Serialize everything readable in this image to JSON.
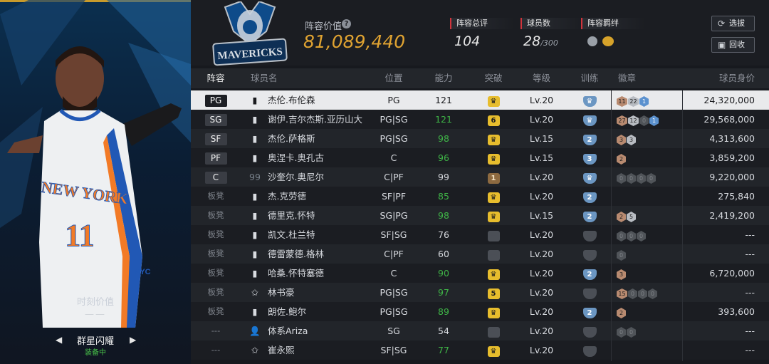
{
  "left_panel": {
    "moment_label": "时刻价值",
    "moment_value": "——",
    "outfit_name": "群星闪耀",
    "equipped_label": "装备中",
    "player_jersey": {
      "team_text": "NEW YORK",
      "number": "11",
      "short": "NYC"
    }
  },
  "header": {
    "team_logo_text": "MAVERICKS",
    "lineup_value_label": "阵容价值",
    "lineup_value": "81,089,440",
    "overall_label": "阵容总评",
    "overall_value": "104",
    "player_count_label": "球员数",
    "player_count_value": "28",
    "player_count_max": "/300",
    "bond_label": "阵容羁绊",
    "select_label": "选拔",
    "back_label": "回收"
  },
  "table": {
    "headers": [
      "阵容",
      "球员名",
      "位置",
      "能力",
      "突破",
      "等级",
      "训练",
      "徽章",
      "球员身价"
    ],
    "rows": [
      {
        "slot": "PG",
        "name": "杰伦.布伦森",
        "pos": "PG",
        "ovr": "121",
        "ovr_green": false,
        "brk": "crown",
        "lv": "Lv.20",
        "train": "crown",
        "badges": [
          [
            "11",
            "bronze"
          ],
          [
            "22",
            "silver"
          ],
          [
            "1",
            "blue"
          ]
        ],
        "value": "24,320,000",
        "selected": true,
        "icon": "bars"
      },
      {
        "slot": "SG",
        "name": "谢伊.吉尔杰斯.亚历山大",
        "pos": "PG|SG",
        "ovr": "121",
        "ovr_green": true,
        "brk": "6",
        "lv": "Lv.20",
        "train": "crown",
        "badges": [
          [
            "27",
            "bronze"
          ],
          [
            "12",
            "silver"
          ],
          [
            "0",
            "grey"
          ],
          [
            "1",
            "blue"
          ]
        ],
        "value": "29,568,000",
        "icon": "bars"
      },
      {
        "slot": "SF",
        "name": "杰伦.萨格斯",
        "pos": "PG|SG",
        "ovr": "98",
        "ovr_green": true,
        "brk": "crown",
        "lv": "Lv.15",
        "train": "2",
        "badges": [
          [
            "3",
            "bronze"
          ],
          [
            "3",
            "silver"
          ]
        ],
        "value": "4,313,600",
        "icon": "bars"
      },
      {
        "slot": "PF",
        "name": "奥涅卡.奥孔古",
        "pos": "C",
        "ovr": "96",
        "ovr_green": true,
        "brk": "crown",
        "lv": "Lv.15",
        "train": "3",
        "badges": [
          [
            "2",
            "bronze"
          ]
        ],
        "value": "3,859,200",
        "icon": "bars"
      },
      {
        "slot": "C",
        "name": "沙奎尔.奥尼尔",
        "pos": "C|PF",
        "ovr": "99",
        "ovr_green": false,
        "brk": "1b",
        "lv": "Lv.20",
        "train": "crown",
        "badges": [
          [
            "0",
            "grey"
          ],
          [
            "0",
            "grey"
          ],
          [
            "0",
            "grey"
          ],
          [
            "0",
            "grey"
          ]
        ],
        "value": "9,220,000",
        "icon": "99"
      },
      {
        "slot": "板凳",
        "name": "杰.克劳德",
        "pos": "SF|PF",
        "ovr": "85",
        "ovr_green": true,
        "brk": "crown",
        "lv": "Lv.20",
        "train": "2",
        "badges": [],
        "value": "275,840",
        "icon": "bars"
      },
      {
        "slot": "板凳",
        "name": "德里克.怀特",
        "pos": "SG|PG",
        "ovr": "98",
        "ovr_green": true,
        "brk": "crown",
        "lv": "Lv.15",
        "train": "2",
        "badges": [
          [
            "2",
            "bronze"
          ],
          [
            "5",
            "silver"
          ]
        ],
        "value": "2,419,200",
        "icon": "bars"
      },
      {
        "slot": "板凳",
        "name": "凯文.杜兰特",
        "pos": "SF|SG",
        "ovr": "76",
        "ovr_green": false,
        "brk": "grey",
        "lv": "Lv.20",
        "train": "grey",
        "badges": [
          [
            "0",
            "grey"
          ],
          [
            "0",
            "grey"
          ],
          [
            "0",
            "grey"
          ]
        ],
        "value": "---",
        "icon": "bars"
      },
      {
        "slot": "板凳",
        "name": "德雷蒙德.格林",
        "pos": "C|PF",
        "ovr": "60",
        "ovr_green": false,
        "brk": "grey",
        "lv": "Lv.20",
        "train": "grey",
        "badges": [
          [
            "0",
            "grey"
          ]
        ],
        "value": "---",
        "icon": "bars"
      },
      {
        "slot": "板凳",
        "name": "哈桑.怀特塞德",
        "pos": "C",
        "ovr": "90",
        "ovr_green": true,
        "brk": "crown",
        "lv": "Lv.20",
        "train": "2",
        "badges": [
          [
            "3",
            "bronze"
          ]
        ],
        "value": "6,720,000",
        "icon": "bars"
      },
      {
        "slot": "板凳",
        "name": "林书豪",
        "pos": "PG|SG",
        "ovr": "97",
        "ovr_green": true,
        "brk": "5",
        "lv": "Lv.20",
        "train": "grey",
        "badges": [
          [
            "15",
            "bronze"
          ],
          [
            "0",
            "grey"
          ],
          [
            "0",
            "grey"
          ],
          [
            "0",
            "grey"
          ]
        ],
        "value": "---",
        "icon": "star"
      },
      {
        "slot": "板凳",
        "name": "朗佐.鲍尔",
        "pos": "PG|SG",
        "ovr": "89",
        "ovr_green": true,
        "brk": "crown",
        "lv": "Lv.20",
        "train": "2",
        "badges": [
          [
            "2",
            "bronze"
          ]
        ],
        "value": "393,600",
        "icon": "bars"
      },
      {
        "slot": "---",
        "name": "体系Ariza",
        "pos": "SG",
        "ovr": "54",
        "ovr_green": false,
        "brk": "grey",
        "lv": "Lv.20",
        "train": "grey",
        "badges": [
          [
            "0",
            "grey"
          ],
          [
            "0",
            "grey"
          ]
        ],
        "value": "---",
        "icon": "person"
      },
      {
        "slot": "---",
        "name": "崔永熙",
        "pos": "SF|SG",
        "ovr": "77",
        "ovr_green": true,
        "brk": "crown",
        "lv": "Lv.20",
        "train": "grey",
        "badges": [],
        "value": "---",
        "icon": "star"
      }
    ]
  }
}
